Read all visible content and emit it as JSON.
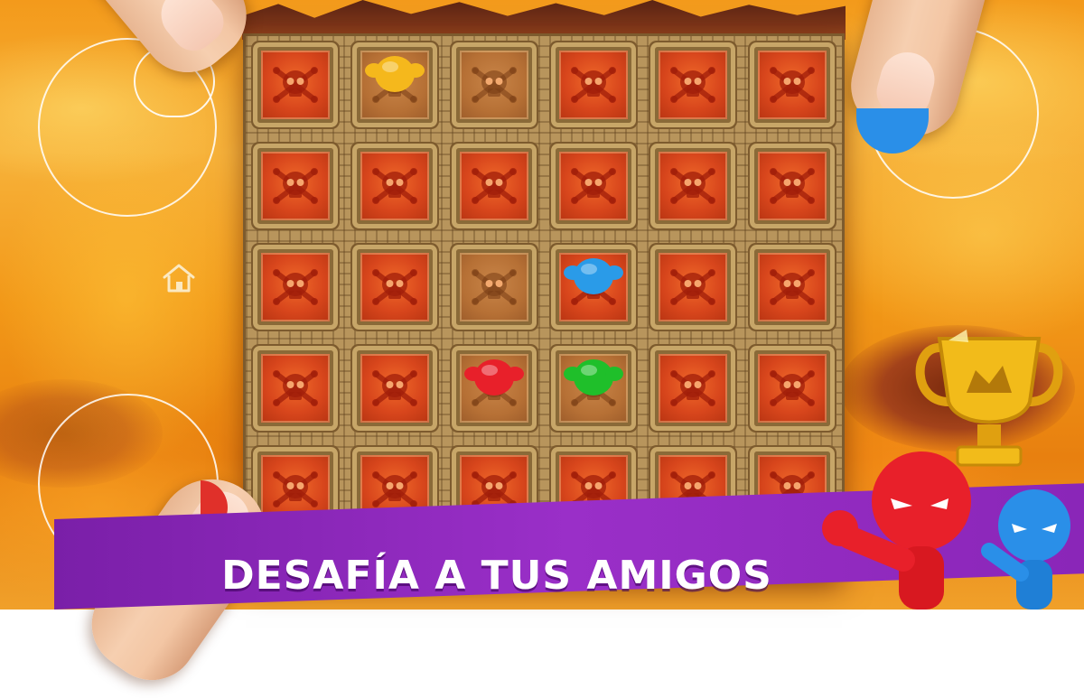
{
  "banner": {
    "text": "DESAFÍA A TUS AMIGOS"
  },
  "board": {
    "rows": 5,
    "cols": 6,
    "safe_tiles": [
      [
        0,
        1
      ],
      [
        0,
        2
      ],
      [
        2,
        2
      ],
      [
        3,
        2
      ],
      [
        3,
        3
      ]
    ],
    "tile_icon": "skull-crossbones-icon"
  },
  "players": [
    {
      "color": "yellow",
      "hex": "#f5b81c",
      "row": 0,
      "col": 1
    },
    {
      "color": "blue",
      "hex": "#2a9be8",
      "row": 2,
      "col": 3
    },
    {
      "color": "red",
      "hex": "#e8202a",
      "row": 3,
      "col": 2
    },
    {
      "color": "green",
      "hex": "#1fbf2a",
      "row": 3,
      "col": 3
    }
  ],
  "controls": {
    "left_top_joystick": "joystick",
    "left_bottom_joystick": "joystick",
    "right_top_joystick": "joystick",
    "home_icon": "home-icon"
  },
  "colors": {
    "banner": "#8a26b8",
    "lava": "#f29818",
    "danger_tile": "#d8461c",
    "safe_tile": "#b67035"
  }
}
